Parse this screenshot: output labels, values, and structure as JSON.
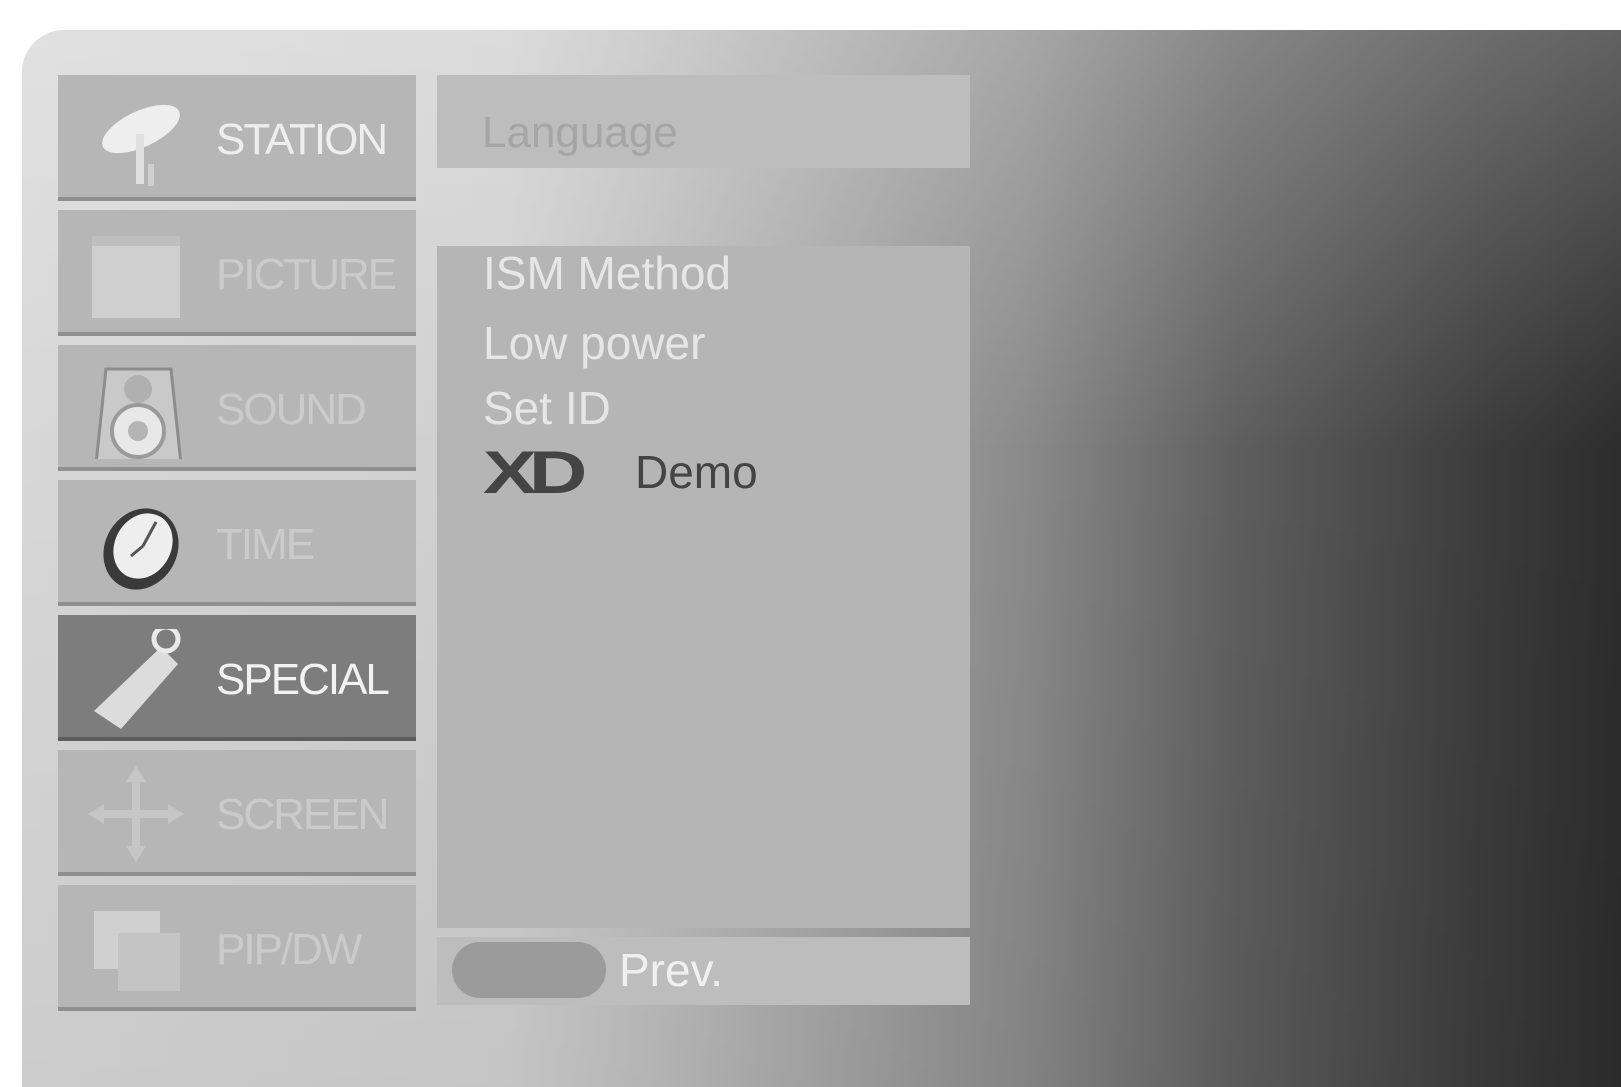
{
  "menu": {
    "tabs": [
      {
        "label": "STATION",
        "icon": "satellite-dish-icon",
        "selected": false
      },
      {
        "label": "PICTURE",
        "icon": "picture-frame-icon",
        "selected": false
      },
      {
        "label": "SOUND",
        "icon": "speaker-icon",
        "selected": false
      },
      {
        "label": "TIME",
        "icon": "clock-icon",
        "selected": false
      },
      {
        "label": "SPECIAL",
        "icon": "tag-icon",
        "selected": true
      },
      {
        "label": "SCREEN",
        "icon": "move-arrows-icon",
        "selected": false
      },
      {
        "label": "PIP/DW",
        "icon": "pip-windows-icon",
        "selected": false
      }
    ]
  },
  "panel": {
    "header": "Language",
    "items": [
      "ISM Method",
      "Low power",
      "Set ID"
    ],
    "xd_logo": "XD",
    "xd_label": "Demo",
    "footer": "Prev."
  },
  "colors": {
    "tab_bg": "#b6b6b6",
    "tab_selected_bg": "#7d7d7d",
    "panel_bg": "#b5b5b5",
    "text_light": "#e6e6e6",
    "text_dark": "#444444"
  }
}
